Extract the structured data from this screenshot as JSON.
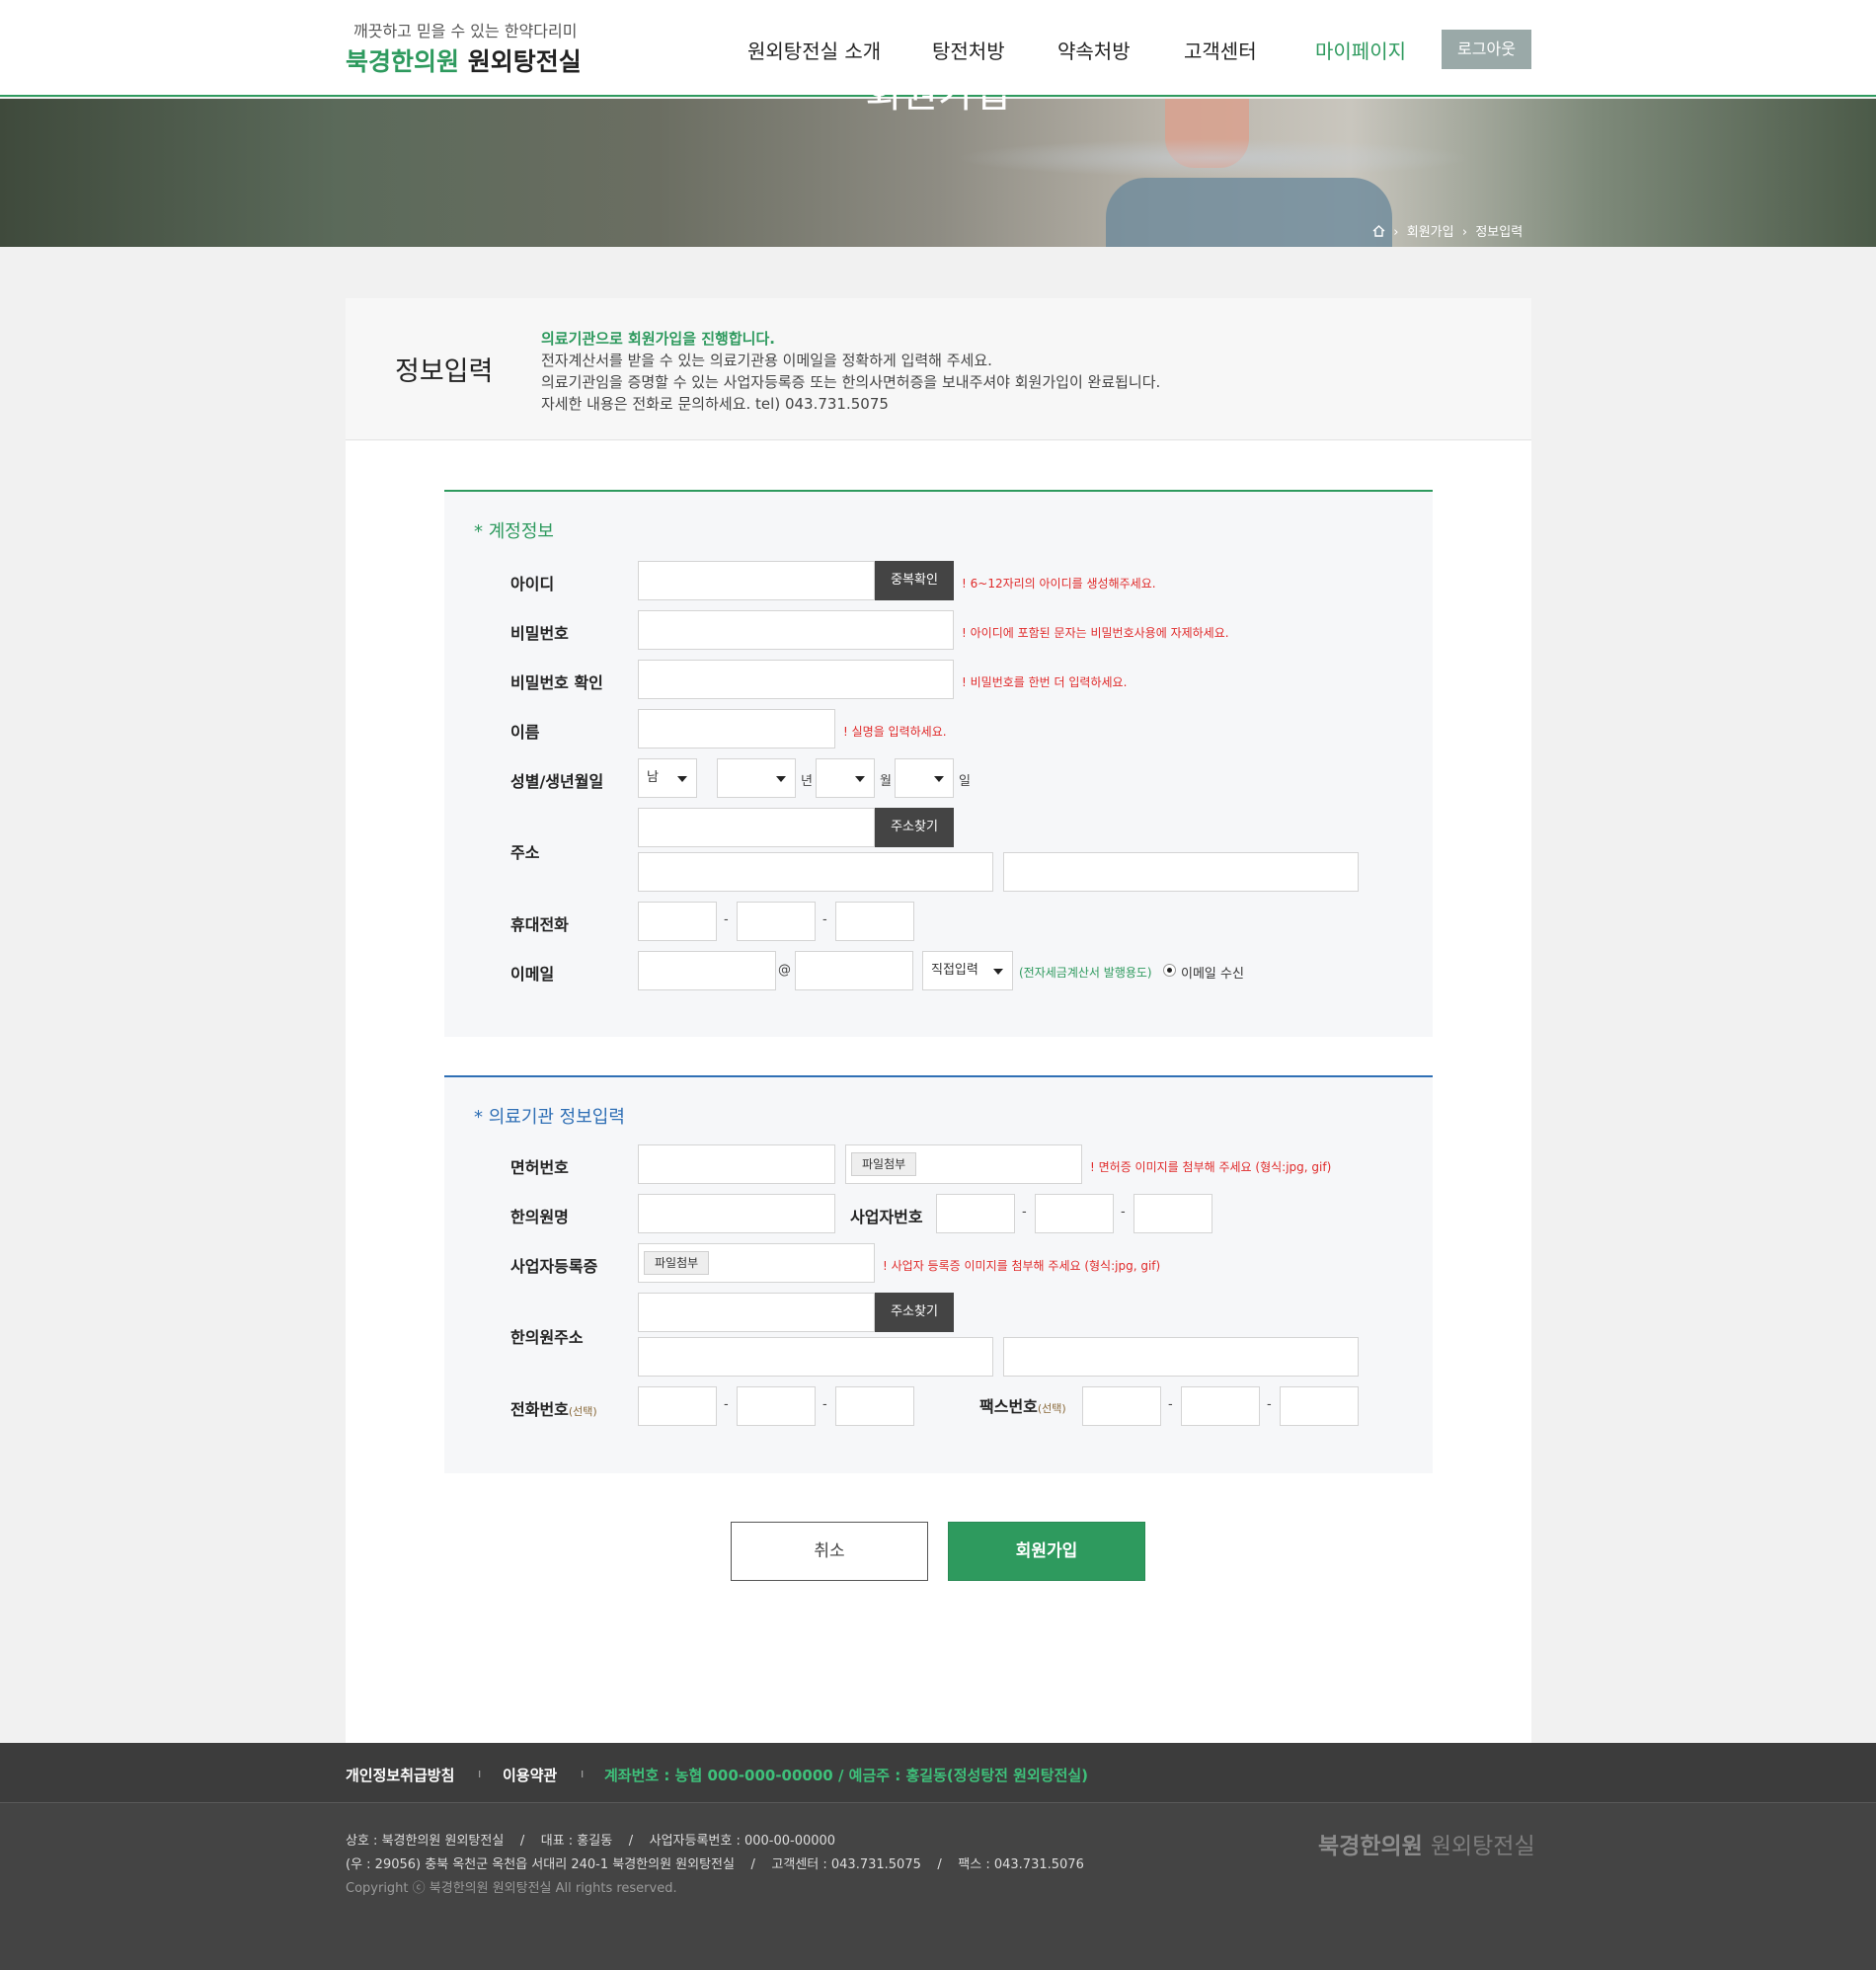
{
  "header": {
    "tagline": "깨끗하고 믿을 수 있는 한약다리미",
    "brand_green": "북경한의원",
    "brand_black": "원외탕전실",
    "nav": [
      "원외탕전실 소개",
      "탕전처방",
      "약속처방",
      "고객센터",
      "마이페이지"
    ],
    "logout": "로그아웃",
    "accent": "#2e9a5e"
  },
  "banner": {
    "title": "회원가입",
    "breadcrumb": [
      "회원가입",
      "정보입력"
    ]
  },
  "intro": {
    "heading": "정보입력",
    "lines": [
      "의료기관으로 회원가입을 진행합니다.",
      "전자계산서를 받을 수 있는 의료기관용 이메일을 정확하게 입력해 주세요.",
      "의료기관임을 증명할 수 있는 사업자등록증 또는 한의사면허증을 보내주셔야 회원가입이 완료됩니다.",
      "자세한 내용은 전화로 문의하세요. tel) 043.731.5075"
    ]
  },
  "account": {
    "title": "* 계정정보",
    "id_label": "아이디",
    "dup_check": "중복확인",
    "id_hint": "! 6~12자리의 아이디를 생성해주세요.",
    "pw_label": "비밀번호",
    "pw_hint": "! 아이디에 포함된 문자는 비밀번호사용에 자제하세요.",
    "pw2_label": "비밀번호 확인",
    "pw2_hint": "! 비밀번호를 한번 더 입력하세요.",
    "name_label": "이름",
    "name_hint": "! 실명을 입력하세요.",
    "gender_label": "성별/생년월일",
    "gender_value": "남",
    "year_unit": "년",
    "month_unit": "월",
    "day_unit": "일",
    "addr_label": "주소",
    "addr_btn": "주소찾기",
    "phone_label": "휴대전화",
    "email_label": "이메일",
    "at": "@",
    "email_select": "직접입력",
    "email_note": "(전자세금계산서 발행용도)",
    "email_receive": "이메일 수신",
    "dash": "-"
  },
  "clinic": {
    "title": "* 의료기관 정보입력",
    "license_label": "면허번호",
    "file_btn": "파일첨부",
    "license_hint": "! 면허증 이미지를 첨부해 주세요 (형식:jpg, gif)",
    "clinic_name_label": "한의원명",
    "biz_no_label": "사업자번호",
    "biz_reg_label": "사업자등록증",
    "biz_reg_hint": "! 사업자 등록증 이미지를 첨부해 주세요 (형식:jpg, gif)",
    "clinic_addr_label": "한의원주소",
    "addr_btn": "주소찾기",
    "tel_label": "전화번호",
    "fax_label": "팩스번호",
    "optional": "(선택)"
  },
  "buttons": {
    "cancel": "취소",
    "submit": "회원가입"
  },
  "footer": {
    "privacy": "개인정보취급방침",
    "terms": "이용약관",
    "account": "계좌번호 : 농협 000-000-00000 / 예금주 : 홍길동(정성탕전 원외탕전실)",
    "info1": "상호 : 북경한의원 원외탕전실    /    대표 : 홍길동    /    사업자등록번호 : 000-00-00000",
    "info2": "(우 : 29056) 충북 옥천군 옥천읍 서대리 240-1 북경한의원 원외탕전실    /    고객센터 : 043.731.5075    /    팩스 : 043.731.5076",
    "copyright": "Copyright ⓒ 북경한의원 원외탕전실 All rights reserved.",
    "logo_a": "북경한의원",
    "logo_b": "원외탕전실"
  }
}
